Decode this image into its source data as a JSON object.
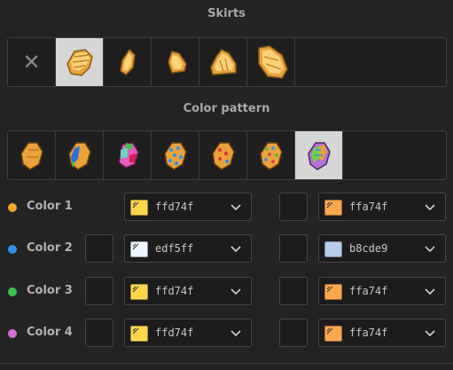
{
  "skirts": {
    "title": "Skirts",
    "tiles": [
      {
        "name": "none",
        "selected": false
      },
      {
        "name": "skirt-1",
        "selected": true
      },
      {
        "name": "skirt-2",
        "selected": false
      },
      {
        "name": "skirt-3",
        "selected": false
      },
      {
        "name": "skirt-4",
        "selected": false
      },
      {
        "name": "skirt-5",
        "selected": false
      }
    ],
    "none_glyph": "✕"
  },
  "pattern": {
    "title": "Color pattern",
    "tiles": [
      {
        "name": "pattern-1",
        "selected": false
      },
      {
        "name": "pattern-2",
        "selected": false
      },
      {
        "name": "pattern-3",
        "selected": false
      },
      {
        "name": "pattern-4",
        "selected": false
      },
      {
        "name": "pattern-5",
        "selected": false
      },
      {
        "name": "pattern-6",
        "selected": false
      },
      {
        "name": "pattern-7",
        "selected": true
      }
    ]
  },
  "colors": [
    {
      "label": "Color 1",
      "dot": "#f5a623",
      "left_checkbox": false,
      "primary": {
        "hex": "ffd74f",
        "swatch": "#ffd74f"
      },
      "secondary": {
        "hex": "ffa74f",
        "swatch": "#ffa74f"
      }
    },
    {
      "label": "Color 2",
      "dot": "#2f8fe8",
      "left_checkbox": true,
      "primary": {
        "hex": "edf5ff",
        "swatch": "#edf5ff"
      },
      "secondary": {
        "hex": "b8cde9",
        "swatch": "#b8cde9"
      }
    },
    {
      "label": "Color 3",
      "dot": "#3cc24a",
      "left_checkbox": true,
      "primary": {
        "hex": "ffd74f",
        "swatch": "#ffd74f"
      },
      "secondary": {
        "hex": "ffa74f",
        "swatch": "#ffa74f"
      }
    },
    {
      "label": "Color 4",
      "dot": "#d36fd6",
      "left_checkbox": true,
      "primary": {
        "hex": "ffd74f",
        "swatch": "#ffd74f"
      },
      "secondary": {
        "hex": "ffa74f",
        "swatch": "#ffa74f"
      }
    }
  ]
}
